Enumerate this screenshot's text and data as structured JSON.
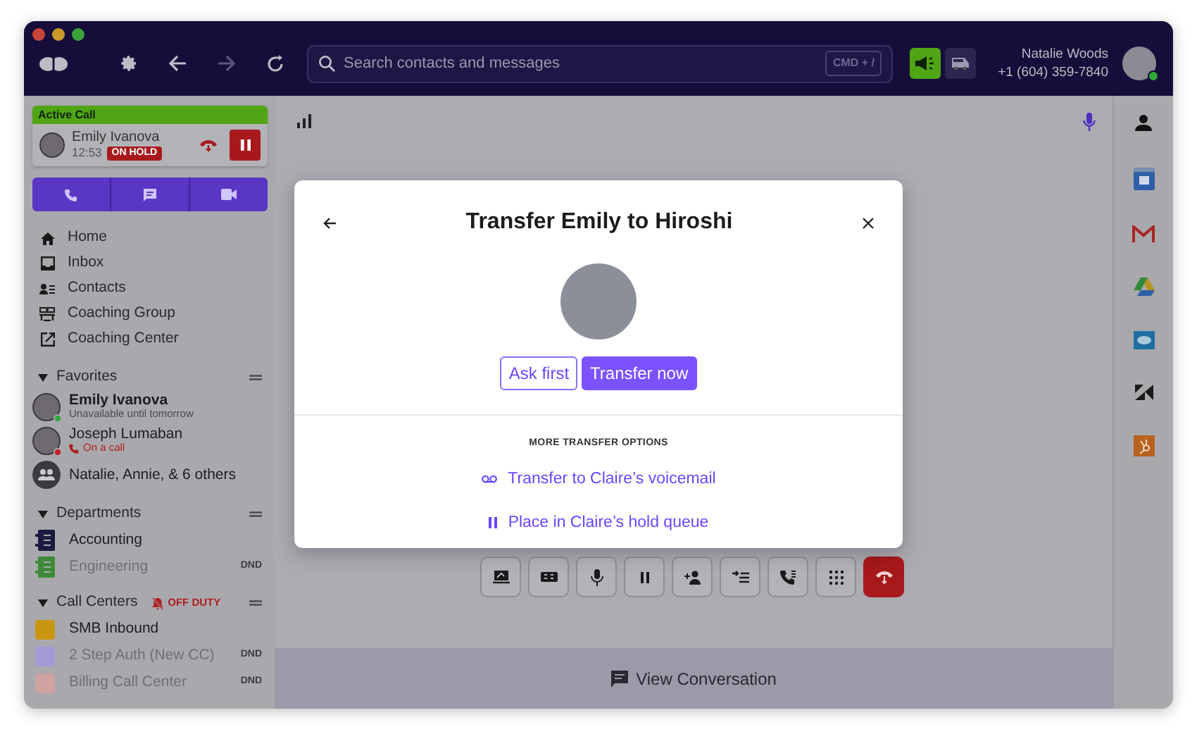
{
  "toolbar": {
    "search": {
      "placeholder": "Search contacts and messages",
      "shortcut": "CMD + /"
    },
    "toggles": [
      {
        "kind": "megaphone",
        "on": true
      },
      {
        "kind": "van",
        "on": false
      }
    ],
    "user": {
      "name": "Natalie Woods",
      "phone": "+1 (604) 359-7840",
      "color": "#2fa83a"
    }
  },
  "active_call": {
    "label": "Active Call",
    "name": "Emily Ivanova",
    "time": "12:53",
    "status": "ON HOLD",
    "on_hold": true
  },
  "nav": [
    "Home",
    "Inbox",
    "Contacts",
    "Coaching Group",
    "Coaching Center"
  ],
  "favorites": {
    "title": "Favorites",
    "expanded": true,
    "items": [
      {
        "kind": "person",
        "name": "Emily Ivanova",
        "status": "Unavailable until tomorrow",
        "color": "#2fa83a",
        "unread": true,
        "on_call": false
      },
      {
        "kind": "person",
        "name": "Joseph Lumaban",
        "status": "On a call",
        "color": "#c81e1e",
        "unread": false,
        "on_call": true
      },
      {
        "kind": "group",
        "name": "Natalie, Annie, & 6 others",
        "unread": false
      }
    ]
  },
  "departments": {
    "title": "Departments",
    "expanded": true,
    "items": [
      {
        "name": "Accounting",
        "color": "#1c1a40",
        "dnd": false
      },
      {
        "name": "Engineering",
        "color": "#3f8a3a",
        "dnd": true,
        "badge": "DND"
      }
    ]
  },
  "call_centers": {
    "title": "Call Centers",
    "duty_status": "OFF DUTY",
    "expanded": true,
    "items": [
      {
        "name": "SMB Inbound",
        "color": "#c8960f",
        "dnd": false
      },
      {
        "name": "2 Step Auth (New CC)",
        "color": "#a49ad6",
        "dnd": true,
        "badge": "DND"
      },
      {
        "name": "Billing Call Center",
        "color": "#cfa2a2",
        "dnd": true,
        "badge": "DND"
      }
    ]
  },
  "main": {
    "view_conversation": "View Conversation"
  },
  "modal": {
    "title": "Transfer Emily to Hiroshi",
    "actions": [
      {
        "label": "Ask first",
        "primary": false
      },
      {
        "label": "Transfer now",
        "primary": true
      }
    ],
    "options_title": "MORE TRANSFER OPTIONS",
    "options": [
      {
        "kind": "voicemail",
        "label": "Transfer to Claire’s voicemail"
      },
      {
        "kind": "hold",
        "label": "Place in Claire’s hold queue"
      }
    ]
  }
}
